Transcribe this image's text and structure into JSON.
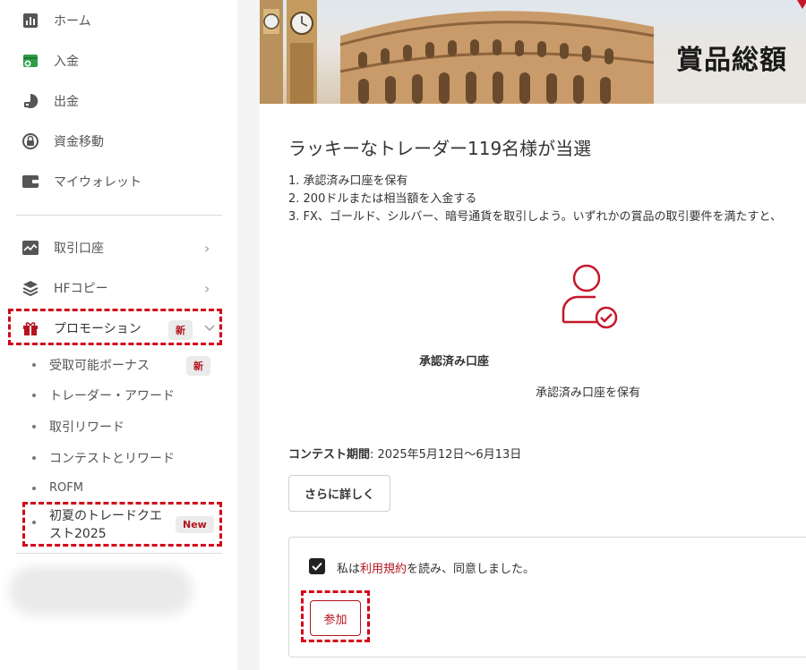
{
  "sidebar": {
    "items": [
      {
        "label": "ホーム",
        "icon": "bar-chart-icon"
      },
      {
        "label": "入金",
        "icon": "deposit-icon"
      },
      {
        "label": "出金",
        "icon": "withdraw-icon"
      },
      {
        "label": "資金移動",
        "icon": "transfer-icon"
      },
      {
        "label": "マイウォレット",
        "icon": "wallet-icon"
      },
      {
        "label": "取引口座",
        "icon": "trading-chart-icon"
      },
      {
        "label": "HFコピー",
        "icon": "layers-icon"
      },
      {
        "label": "プロモーション",
        "icon": "gift-icon"
      }
    ],
    "promotion_badge": "新",
    "sub_items": [
      {
        "label": "受取可能ボーナス",
        "badge": "新"
      },
      {
        "label": "トレーダー・アワード"
      },
      {
        "label": "取引リワード"
      },
      {
        "label": "コンテストとリワード"
      },
      {
        "label": "ROFM"
      },
      {
        "label_line1": "初夏のトレードクエ",
        "label_line2": "スト2025",
        "badge": "New"
      }
    ]
  },
  "main": {
    "banner_title": "賞品総額",
    "heading": "ラッキーなトレーダー119名様が当選",
    "requirements": [
      "1. 承認済み口座を保有",
      "2. 200ドルまたは相当額を入金する",
      "3. FX、ゴールド、シルバー、暗号通貨を取引しよう。いずれかの賞品の取引要件を満たすと、"
    ],
    "step": {
      "icon": "verified-user-icon",
      "title": "承認済み口座",
      "desc": "承認済み口座を保有"
    },
    "period_label": "コンテスト期間",
    "period_value": ": 2025年5月12日〜6月13日",
    "more_button": "さらに詳しく",
    "agree_prefix": "私は",
    "agree_link": "利用規約",
    "agree_suffix": "を読み、同意しました。",
    "join_button": "参加"
  },
  "colors": {
    "accent": "#b3141e",
    "highlight": "#d4001a",
    "green_icon": "#2e9e46"
  }
}
